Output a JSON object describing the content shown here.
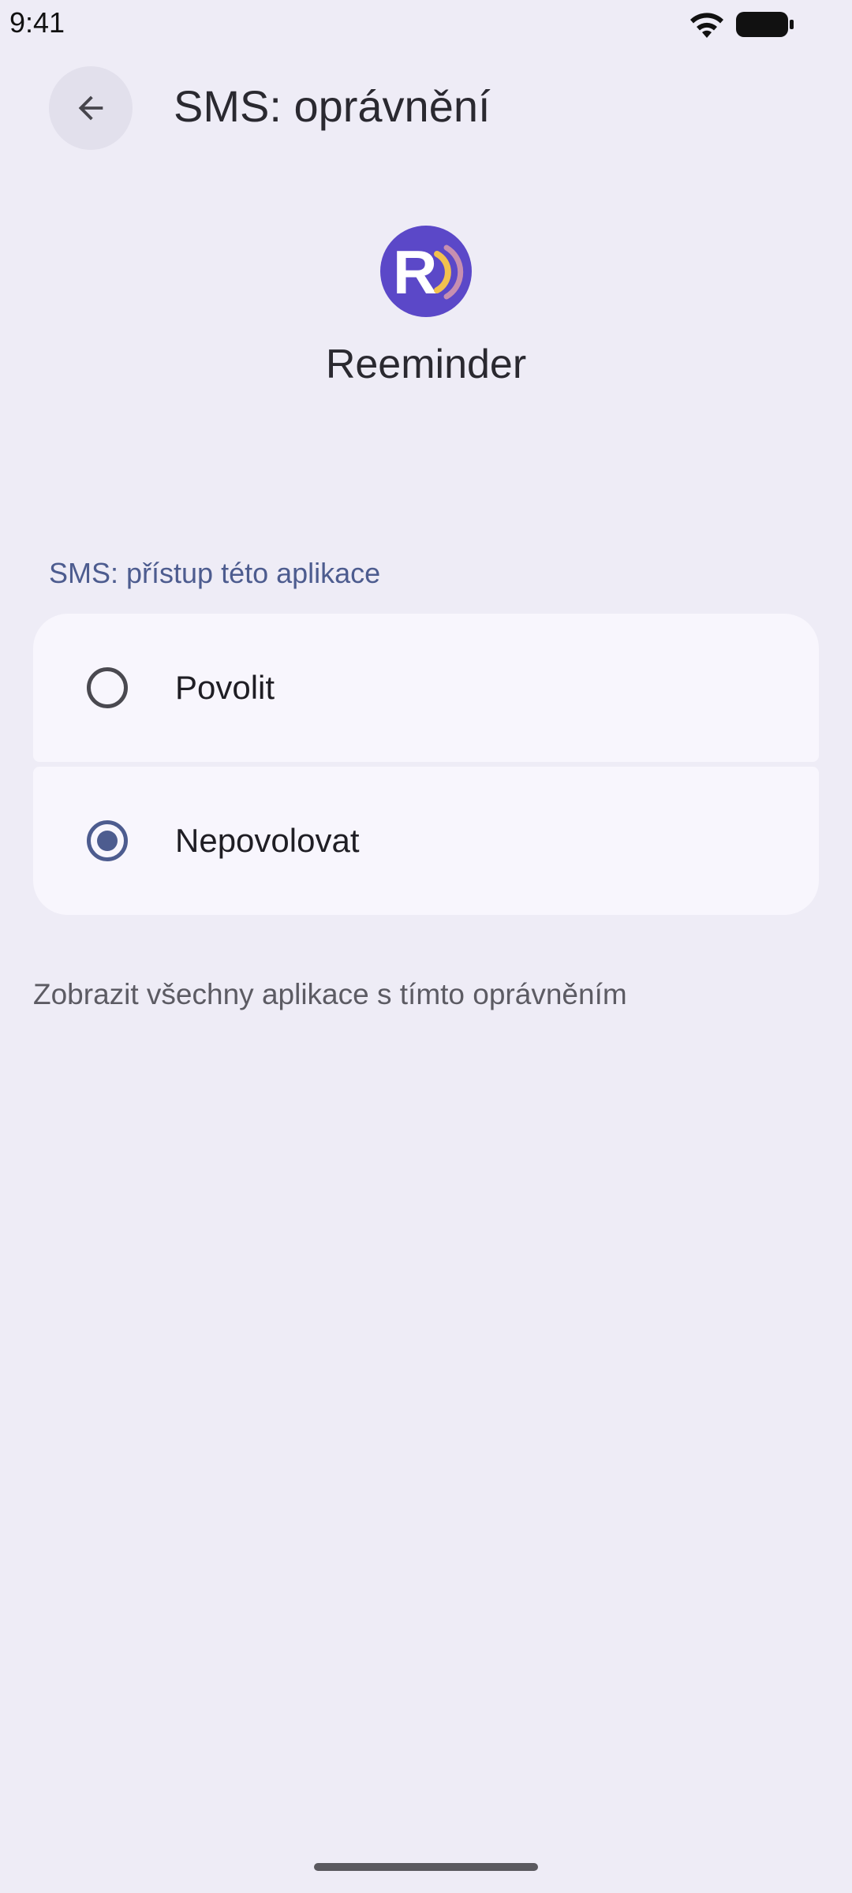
{
  "status_bar": {
    "time": "9:41",
    "wifi_icon": "wifi-icon",
    "battery_icon": "battery-icon"
  },
  "app_bar": {
    "back_icon": "arrow-back-icon",
    "title": "SMS: oprávnění"
  },
  "app": {
    "icon": "reeminder-app-icon",
    "icon_letter": "R",
    "name": "Reeminder",
    "colors": {
      "icon_background": "#5b48c8",
      "icon_wave_inner": "#f2c14e",
      "icon_wave_outer": "#c78fb0"
    }
  },
  "permission": {
    "section_label": "SMS: přístup této aplikace",
    "options": [
      {
        "label": "Povolit",
        "selected": false
      },
      {
        "label": "Nepovolovat",
        "selected": true
      }
    ]
  },
  "footer_link": "Zobrazit všechny aplikace s tímto oprávněním",
  "colors": {
    "background": "#eeecf6",
    "card": "#f8f6fd",
    "accent": "#4d5c8f",
    "text_primary": "#1f1e24",
    "text_secondary": "#5c5b63"
  }
}
